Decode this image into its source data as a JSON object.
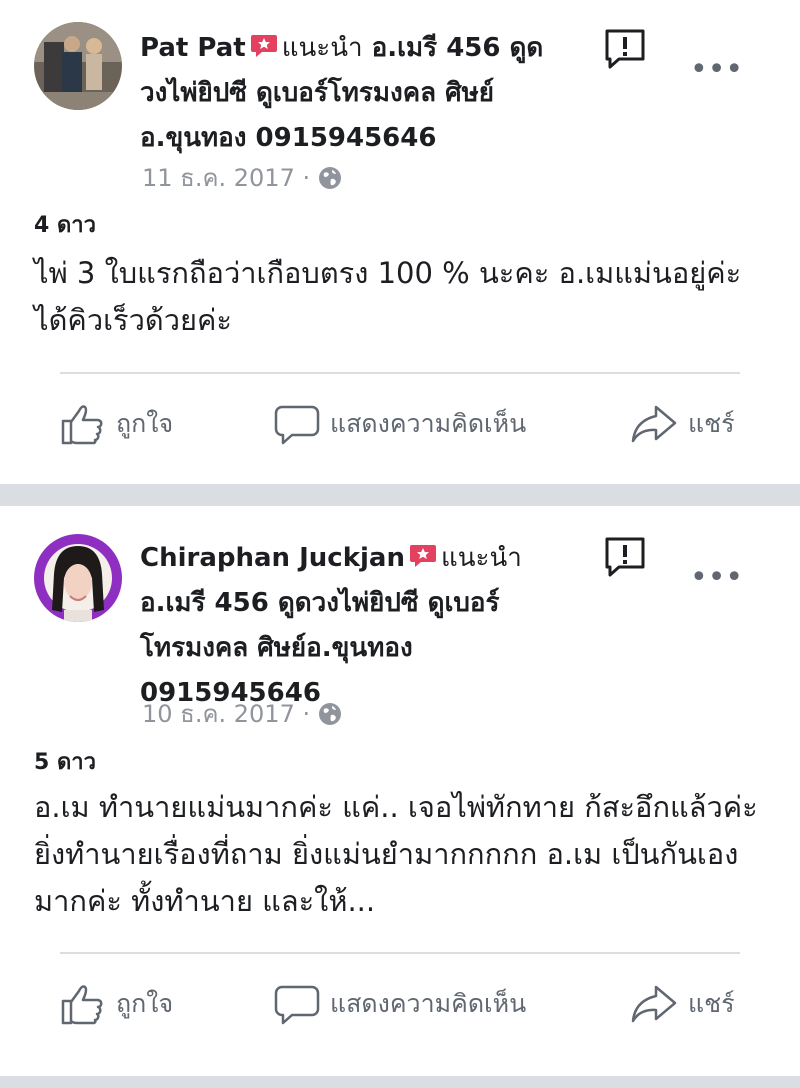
{
  "posts": [
    {
      "author": "Pat Pat",
      "recommends_label": "แนะนำ",
      "page_line1": "อ.เมรี 456 ดูด",
      "page_line2": "วงไพ่ยิปซี ดูเบอร์โทรมงคล ศิษย์",
      "page_line3": "อ.ขุนทอง 0915945646",
      "date": "11 ธ.ค. 2017 ·",
      "stars": "4 ดาว",
      "text": "ไพ่ 3 ใบแรกถือว่าเกือบตรง 100 % นะคะ อ.เมแม่นอยู่ค่ะ ได้คิวเร็วด้วยค่ะ"
    },
    {
      "author": "Chiraphan Juckjan",
      "recommends_label": "แนะนำ",
      "page_line1": "อ.เมรี 456 ดูดวงไพ่ยิปซี ดูเบอร์",
      "page_line2": "โทรมงคล ศิษย์อ.ขุนทอง",
      "page_line3": "0915945646",
      "date": "10 ธ.ค. 2017 ·",
      "stars": "5 ดาว",
      "text": "อ.เม ทำนายแม่นมากค่ะ แค่.. เจอไพ่ทักทาย ก้สะอึกแล้วค่ะ ยิ่งทำนายเรื่องที่ถาม ยิ่งแม่นยำมากกกกก  อ.เม เป็นกันเองมากค่ะ ทั้งทำนาย และให้..."
    }
  ],
  "actions": {
    "like": "ถูกใจ",
    "comment": "แสดงความคิดเห็น",
    "share": "แชร์"
  },
  "colors": {
    "badge": "#e4405f",
    "divider": "#dadde1",
    "meta": "#90949c",
    "action": "#606770"
  },
  "icons": [
    "recommend-badge-icon",
    "globe-icon",
    "report-icon",
    "more-icon",
    "like-icon",
    "comment-icon",
    "share-icon"
  ]
}
